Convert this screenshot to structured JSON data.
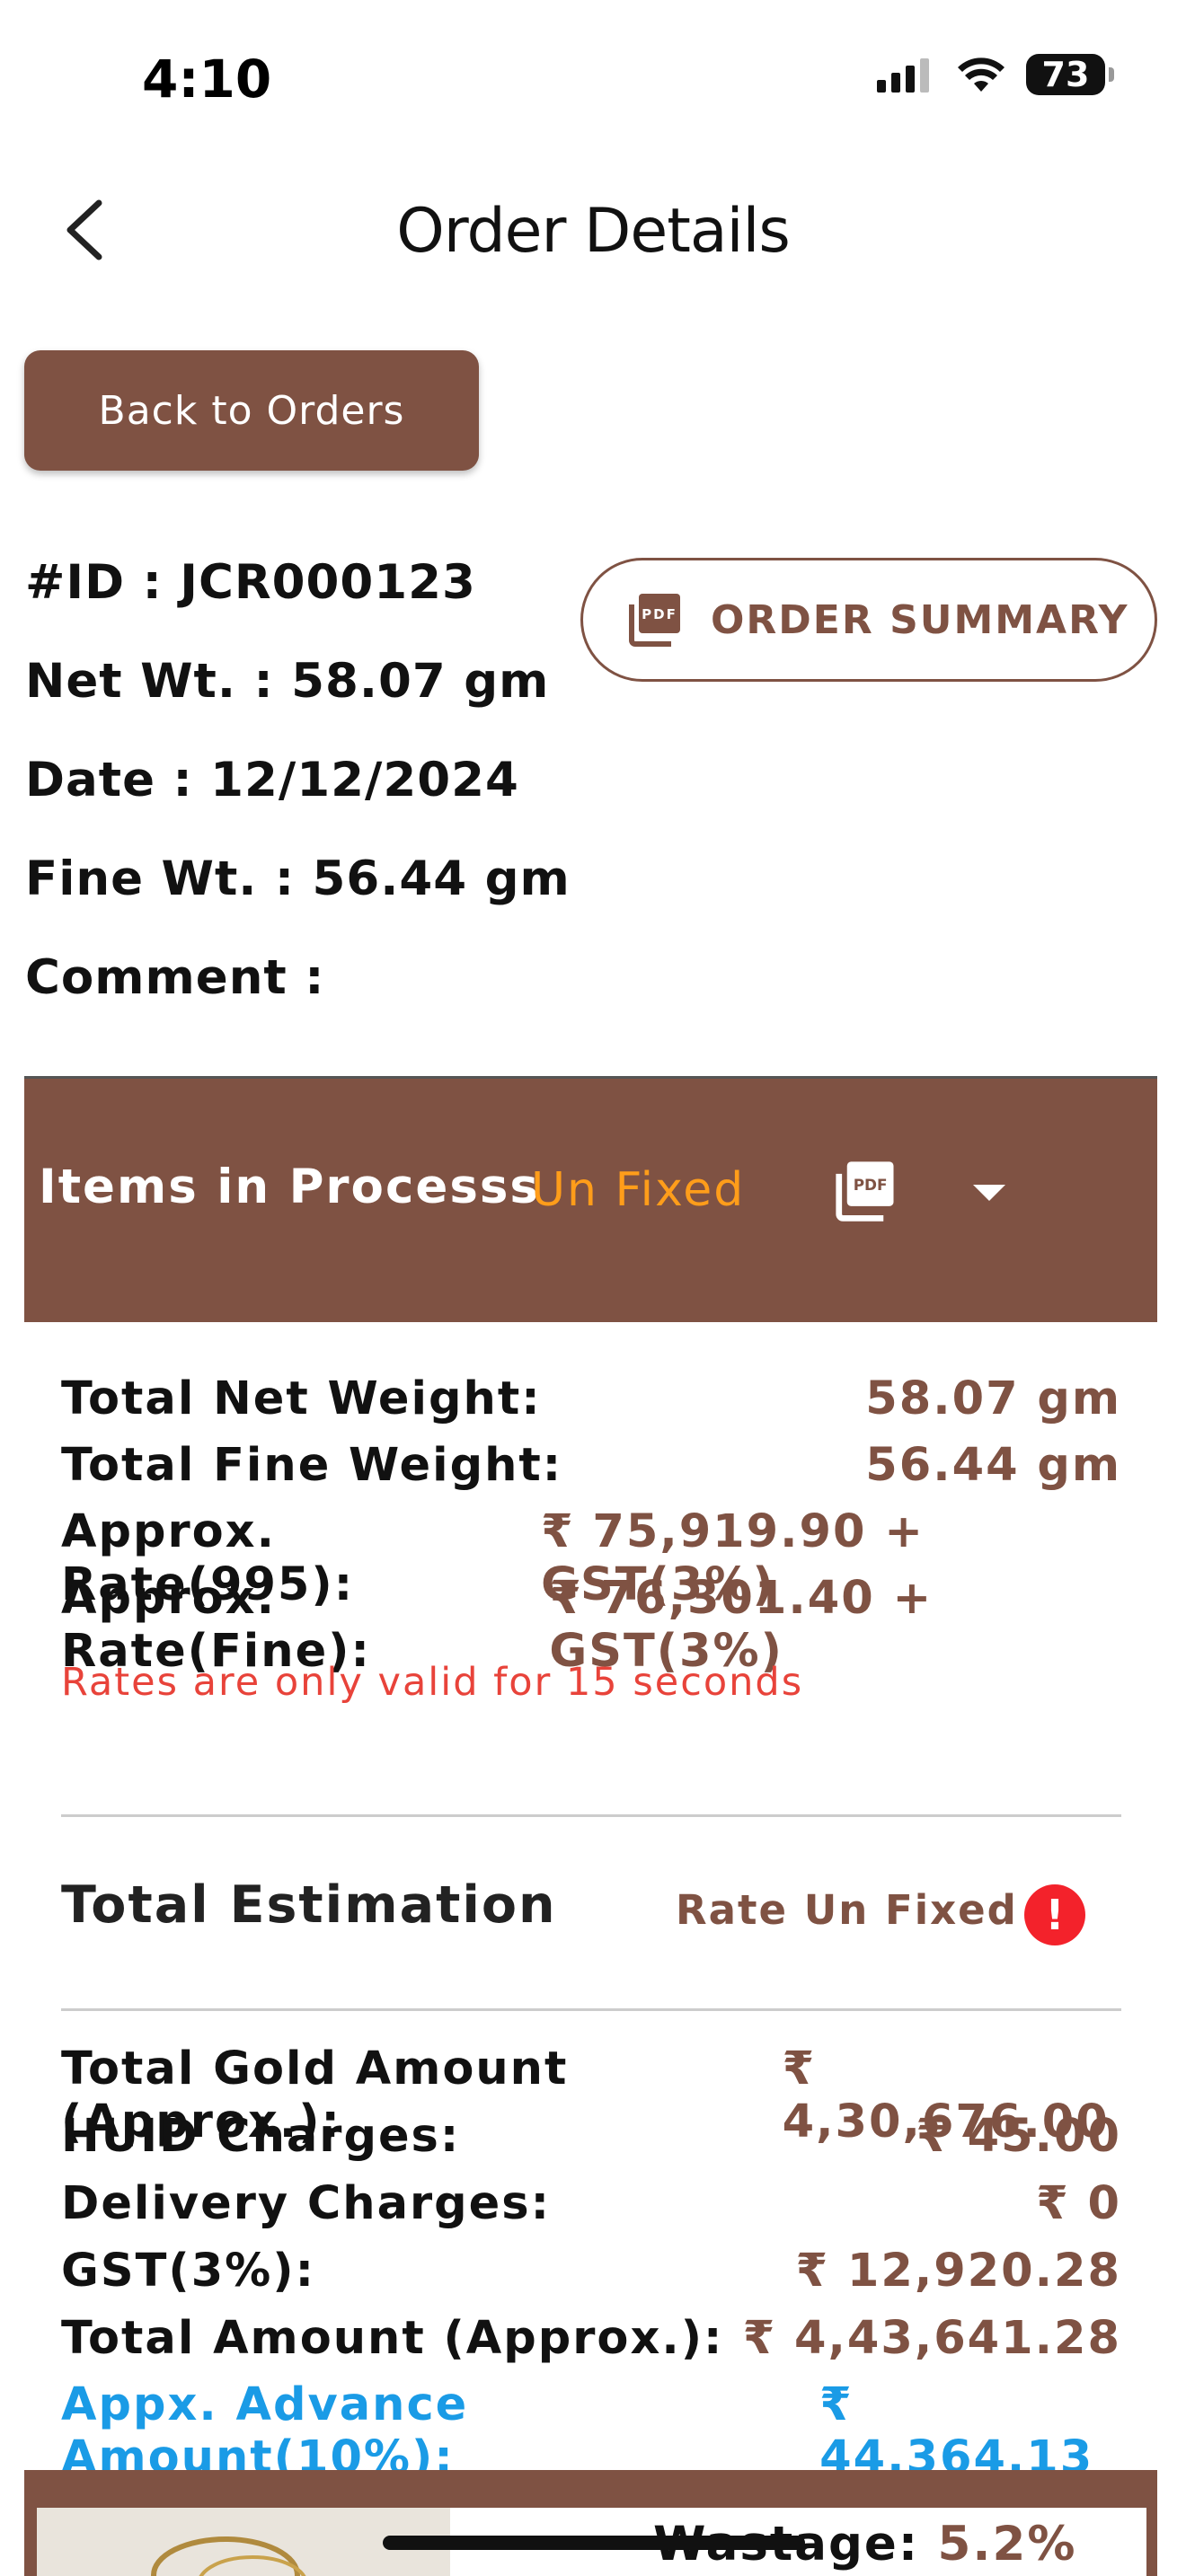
{
  "status_bar": {
    "time": "4:10",
    "battery": "73"
  },
  "nav": {
    "title": "Order Details"
  },
  "actions": {
    "back_to_orders": "Back to Orders",
    "order_summary": "ORDER SUMMARY"
  },
  "order": {
    "id_line": "#ID : JCR000123",
    "net_wt_line": "Net Wt. : 58.07 gm",
    "date_line": "Date : 12/12/2024",
    "fine_wt_line": "Fine Wt. : 56.44 gm",
    "comment_line": "Comment :"
  },
  "process": {
    "title": "Items in Processs",
    "status": "Un Fixed",
    "pdf_icon": "pdf-icon",
    "dropdown_icon": "caret-down-icon"
  },
  "weights": [
    {
      "label": "Total Net Weight:",
      "value": "58.07 gm"
    },
    {
      "label": "Total Fine Weight:",
      "value": "56.44 gm"
    },
    {
      "label": "Approx. Rate(995):",
      "value": "₹ 75,919.90 + GST(3%)"
    },
    {
      "label": "Approx. Rate(Fine):",
      "value": "₹ 76,301.40 + GST(3%)"
    }
  ],
  "rate_warning": "Rates are only valid for 15 seconds",
  "estimation": {
    "title": "Total Estimation",
    "status": "Rate Un Fixed",
    "alert_glyph": "!",
    "rows": [
      {
        "label": "Total Gold Amount (Approx.):",
        "value": "₹ 4,30,676.00"
      },
      {
        "label": "HUID Charges:",
        "value": "₹ 45.00"
      },
      {
        "label": "Delivery Charges:",
        "value": "₹ 0"
      },
      {
        "label": "GST(3%):",
        "value": "₹ 12,920.28"
      },
      {
        "label": "Total Amount (Approx.):",
        "value": "₹ 4,43,641.28"
      },
      {
        "label": "Appx. Advance Amount(10%):",
        "value": "₹ 44,364.13"
      }
    ]
  },
  "item_preview": {
    "wastage_label": "Wastage:",
    "wastage_value": "5.2%"
  },
  "colors": {
    "brand": "#7f5243",
    "unfixed": "#ff9d1a",
    "warning": "#e8433a",
    "advance": "#1a9be6",
    "alert": "#f3222b"
  }
}
